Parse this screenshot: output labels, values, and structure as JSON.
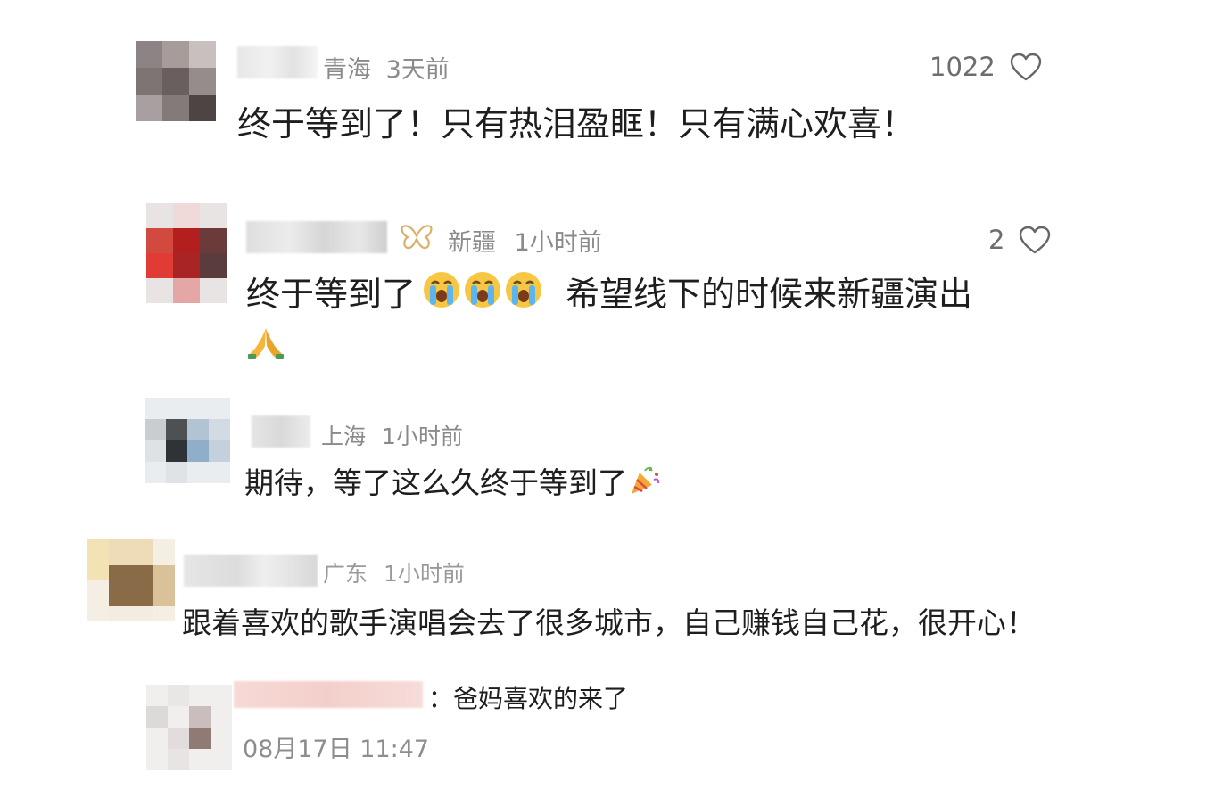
{
  "comments": [
    {
      "location": "青海",
      "time": "3天前",
      "likes": "1022",
      "text": "终于等到了！只有热泪盈眶！只有满心欢喜！"
    },
    {
      "location": "新疆",
      "time": "1小时前",
      "likes": "2",
      "text": "终于等到了",
      "text_after_emoji": "希望线下的时候来新疆演出",
      "emoji_crying": "loudly-crying-face-icon",
      "emoji_pray": "folded-hands-icon",
      "badge_icon": "butterfly-badge-icon"
    },
    {
      "location": "上海",
      "time": "1小时前",
      "text": "期待，等了这么久终于等到了",
      "emoji_party": "party-popper-icon"
    },
    {
      "location": "广东",
      "time": "1小时前",
      "text": "跟着喜欢的歌手演唱会去了很多城市，自己赚钱自己花，很开心！"
    },
    {
      "reply_text": "：爸妈喜欢的来了",
      "date": "08月17日 11:47"
    }
  ],
  "colors": {
    "text": "#1e1e1e",
    "meta": "#8a8a8a",
    "heart": "#666666"
  }
}
